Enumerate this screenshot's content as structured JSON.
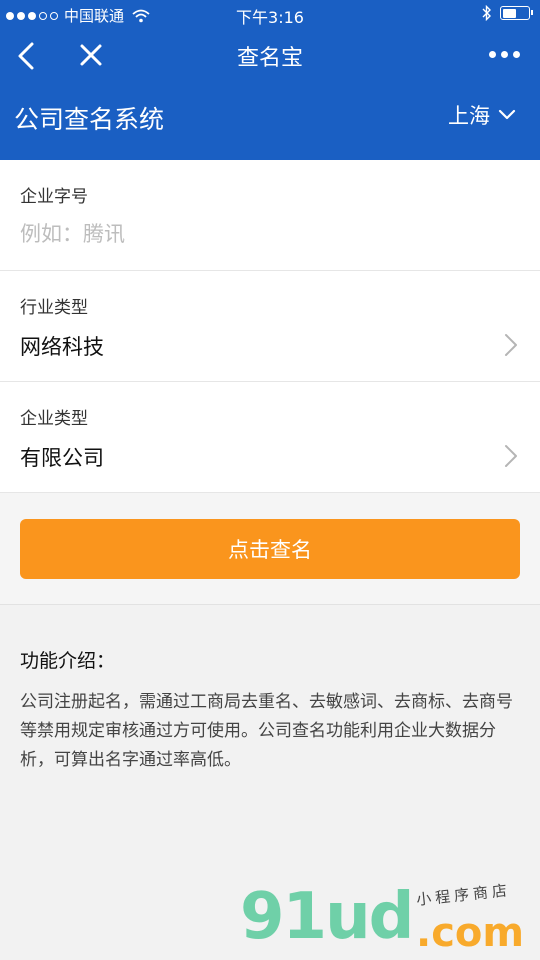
{
  "status_bar": {
    "carrier": "中国联通",
    "time": "下午3:16",
    "battery_level": 0.55
  },
  "nav": {
    "title": "查名宝",
    "back_icon": "chevron-left-icon",
    "close_icon": "close-icon",
    "more_icon": "more-dots-icon"
  },
  "header": {
    "title": "公司查名系统",
    "city": "上海"
  },
  "form": {
    "brand_label": "企业字号",
    "brand_placeholder": "例如：腾讯",
    "brand_value": "",
    "industry_label": "行业类型",
    "industry_value": "网络科技",
    "company_type_label": "企业类型",
    "company_type_value": "有限公司"
  },
  "search_button": {
    "label": "点击查名"
  },
  "intro": {
    "title": "功能介绍：",
    "text": "公司注册起名，需通过工商局去重名、去敏感词、去商标、去商号等禁用规定审核通过方可使用。公司查名功能利用企业大数据分析，可算出名字通过率高低。"
  },
  "watermark": {
    "brand": "91ud",
    "domain": ".com",
    "tagline": "小程序商店"
  },
  "colors": {
    "header_blue": "#1a5fc3",
    "button_orange": "#fa951d"
  }
}
